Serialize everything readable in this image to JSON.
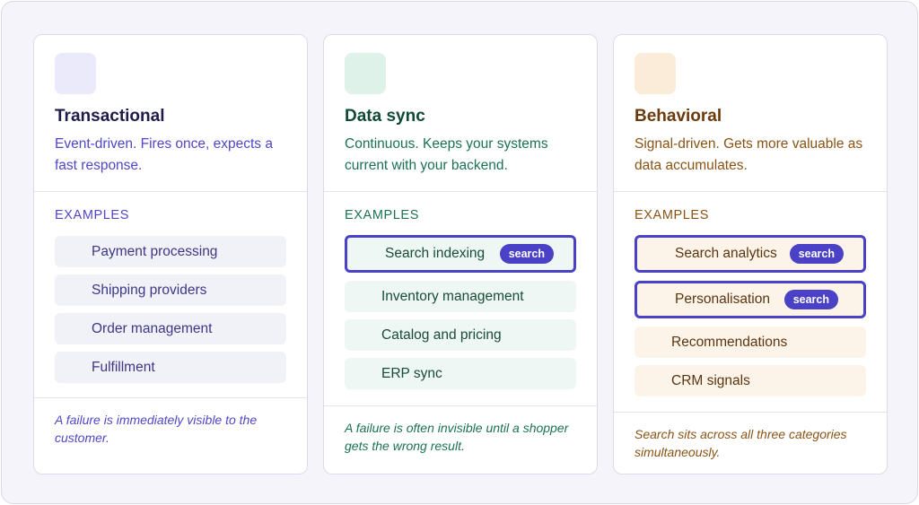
{
  "colors": {
    "accent": "#4a41c6",
    "transactional": "#4f46c8",
    "data_sync": "#1b7251",
    "behavioral": "#8a5314"
  },
  "cards": [
    {
      "title": "Transactional",
      "description": "Event-driven. Fires once, expects a fast response.",
      "examples_label": "EXAMPLES",
      "items": [
        {
          "label": "Payment processing"
        },
        {
          "label": "Shipping providers"
        },
        {
          "label": "Order management"
        },
        {
          "label": "Fulfillment"
        }
      ],
      "footnote": "A failure is immediately visible to the customer."
    },
    {
      "title": "Data sync",
      "description": "Continuous. Keeps your systems current with your backend.",
      "examples_label": "EXAMPLES",
      "items": [
        {
          "label": "Search indexing",
          "badge": "search"
        },
        {
          "label": "Inventory management"
        },
        {
          "label": "Catalog and pricing"
        },
        {
          "label": "ERP sync"
        }
      ],
      "footnote": "A failure is often invisible until a shopper gets the wrong result."
    },
    {
      "title": "Behavioral",
      "description": "Signal-driven. Gets more valuable as data accumulates.",
      "examples_label": "EXAMPLES",
      "items": [
        {
          "label": "Search analytics",
          "badge": "search"
        },
        {
          "label": "Personalisation",
          "badge": "search"
        },
        {
          "label": "Recommendations"
        },
        {
          "label": "CRM signals"
        }
      ],
      "footnote": "Search sits across all three categories simultaneously."
    }
  ]
}
